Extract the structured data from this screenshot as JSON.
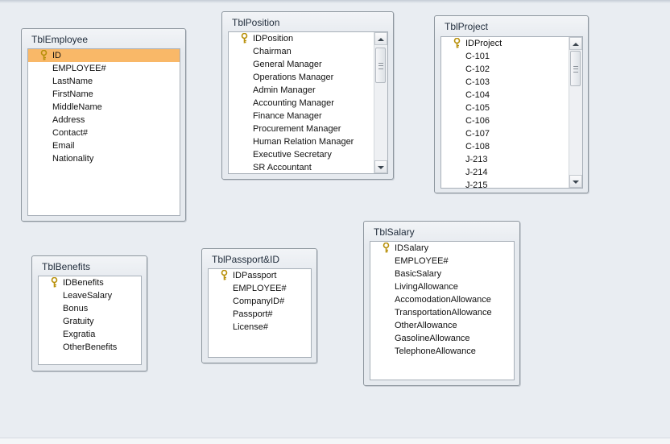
{
  "tables": [
    {
      "id": "tblemployee",
      "title": "TblEmployee",
      "key_field": "ID",
      "selected_field": "ID",
      "fields": [
        "ID",
        "EMPLOYEE#",
        "LastName",
        "FirstName",
        "MiddleName",
        "Address",
        "Contact#",
        "Email",
        "Nationality"
      ],
      "scrollbar": false
    },
    {
      "id": "tblposition",
      "title": "TblPosition",
      "key_field": "IDPosition",
      "selected_field": null,
      "fields": [
        "IDPosition",
        "Chairman",
        "General Manager",
        "Operations Manager",
        "Admin Manager",
        "Accounting Manager",
        "Finance Manager",
        "Procurement Manager",
        "Human Relation Manager",
        "Executive Secretary",
        "SR Accountant"
      ],
      "scrollbar": true
    },
    {
      "id": "tblproject",
      "title": "TblProject",
      "key_field": "IDProject",
      "selected_field": null,
      "fields": [
        "IDProject",
        "C-101",
        "C-102",
        "C-103",
        "C-104",
        "C-105",
        "C-106",
        "C-107",
        "C-108",
        "J-213",
        "J-214",
        "J-215"
      ],
      "scrollbar": true
    },
    {
      "id": "tblbenefits",
      "title": "TblBenefits",
      "key_field": "IDBenefits",
      "selected_field": null,
      "fields": [
        "IDBenefits",
        "LeaveSalary",
        "Bonus",
        "Gratuity",
        "Exgratia",
        "OtherBenefits"
      ],
      "scrollbar": false
    },
    {
      "id": "tblpassport",
      "title": "TblPassport&ID",
      "key_field": "IDPassport",
      "selected_field": null,
      "fields": [
        "IDPassport",
        "EMPLOYEE#",
        "CompanyID#",
        "Passport#",
        "License#"
      ],
      "scrollbar": false
    },
    {
      "id": "tblsalary",
      "title": "TblSalary",
      "key_field": "IDSalary",
      "selected_field": null,
      "fields": [
        "IDSalary",
        "EMPLOYEE#",
        "BasicSalary",
        "LivingAllowance",
        "AccomodationAllowance",
        "TransportationAllowance",
        "OtherAllowance",
        "GasolineAllowance",
        "TelephoneAllowance"
      ],
      "scrollbar": false
    }
  ],
  "colors": {
    "selected_row": "#f9b868",
    "canvas": "#e9edf2",
    "key_icon": "#b8900a"
  },
  "icons": {
    "primary_key": "key-icon",
    "scroll_up": "scroll-up-arrow-icon",
    "scroll_down": "scroll-down-arrow-icon"
  }
}
